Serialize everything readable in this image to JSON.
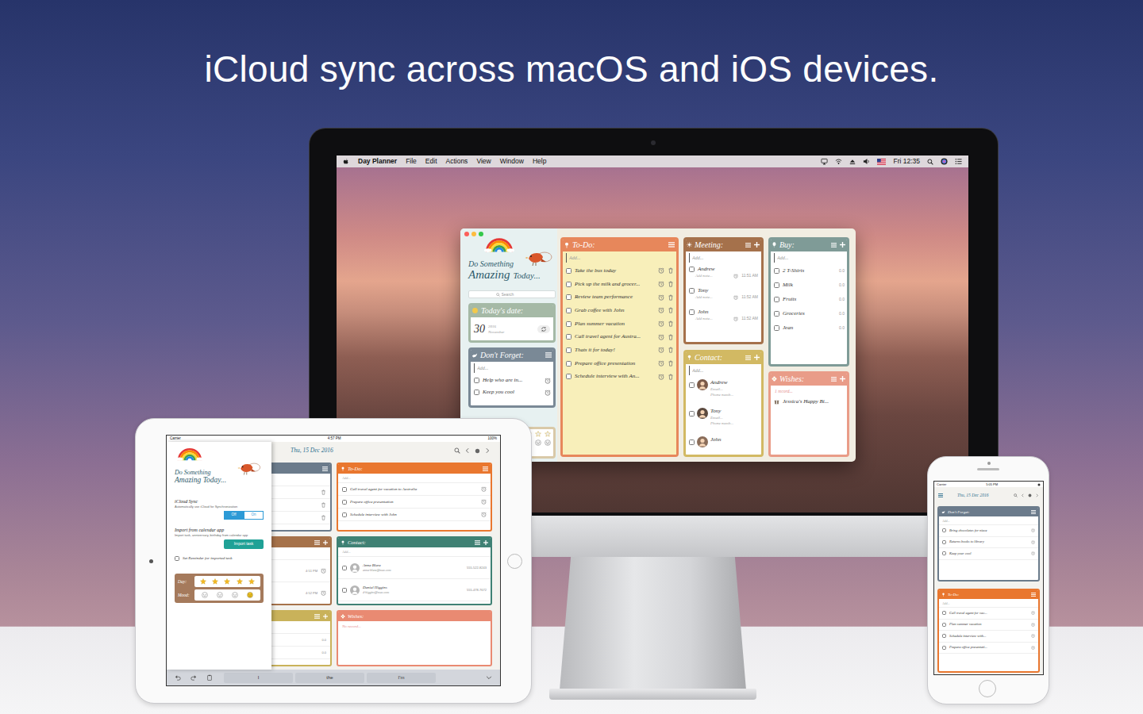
{
  "headline": "iCloud sync across macOS and iOS devices.",
  "mac": {
    "menu_bar": {
      "app": "Day Planner",
      "menus": [
        "File",
        "Edit",
        "Actions",
        "View",
        "Window",
        "Help"
      ],
      "clock": "Fri 12:35"
    },
    "logo": [
      "Do Something",
      "Amazing",
      "Today..."
    ],
    "search": {
      "placeholder": "Search"
    },
    "today": {
      "title": "Today's date:",
      "day": "30",
      "year": "2016",
      "month": "November"
    },
    "dont_forget": {
      "title": "Don't Forget:",
      "placeholder": "Add...",
      "items": [
        {
          "text": "Help who are in...",
          "checked": false
        },
        {
          "text": "Keep you cool",
          "checked": false
        }
      ]
    },
    "rating": {
      "stars": 0
    },
    "todo": {
      "title": "To-Do:",
      "placeholder": "Add...",
      "items": [
        {
          "text": "Take the bus today",
          "checked": false
        },
        {
          "text": "Pick up the milk and grocer...",
          "checked": false
        },
        {
          "text": "Review team performance",
          "checked": false
        },
        {
          "text": "Grab coffee with John",
          "checked": false
        },
        {
          "text": "Plan summer vacation",
          "checked": false
        },
        {
          "text": "Call travel agent for Austra...",
          "checked": false
        },
        {
          "text": "Thats it for today!",
          "checked": false
        },
        {
          "text": "Prepare office presentation",
          "checked": false
        },
        {
          "text": "Schedule interview with An...",
          "checked": false
        }
      ]
    },
    "meeting": {
      "title": "Meeting:",
      "placeholder": "Add...",
      "items": [
        {
          "name": "Andrew",
          "note": "Add note...",
          "time": "11:51 AM",
          "checked": false
        },
        {
          "name": "Tony",
          "note": "Add note...",
          "time": "11:52 AM",
          "checked": false
        },
        {
          "name": "John",
          "note": "Add note...",
          "time": "11:52 AM",
          "checked": false
        }
      ]
    },
    "buy": {
      "title": "Buy:",
      "placeholder": "Add...",
      "items": [
        {
          "name": "2 T-Shirts",
          "price": "0.0",
          "checked": false
        },
        {
          "name": "Milk",
          "price": "0.0",
          "checked": false
        },
        {
          "name": "Fruits",
          "price": "0.0",
          "checked": false
        },
        {
          "name": "Groceries",
          "price": "0.0",
          "checked": false
        },
        {
          "name": "Jean",
          "price": "0.0",
          "checked": false
        }
      ]
    },
    "contact": {
      "title": "Contact:",
      "placeholder": "Add...",
      "items": [
        {
          "name": "Andrew",
          "email": "Email...",
          "phone": "Phone numb...",
          "checked": false
        },
        {
          "name": "Tony",
          "email": "Email...",
          "phone": "Phone numb...",
          "checked": false
        },
        {
          "name": "John",
          "checked": false
        }
      ]
    },
    "wishes": {
      "title": "Wishes:",
      "count": "1 record...",
      "items": [
        "Jessica's Happy Bi..."
      ]
    }
  },
  "ipad": {
    "status": {
      "carrier": "Carrier",
      "time": "4:57 PM",
      "battery": "100%"
    },
    "date": "Thu, 15 Dec 2016",
    "sidebar": {
      "logo": [
        "Do Something",
        "Amazing Today..."
      ],
      "icloud": {
        "title": "iCloud Sync",
        "subtitle": "Automatically use iCloud for Synchronization",
        "options": [
          {
            "label": "Off",
            "selected": true
          },
          {
            "label": "On",
            "selected": false
          }
        ]
      },
      "import": {
        "title": "Import from calendar app",
        "subtitle": "Import task, anniversary, birthday from calendar app",
        "button": "Import task"
      },
      "reminder": {
        "label": "Set Reminder for imported task",
        "checked": false
      },
      "day": {
        "label": "Day:",
        "stars": 5
      },
      "mood": {
        "label": "Mood:",
        "options": [
          {
            "selected": false
          },
          {
            "selected": false
          },
          {
            "selected": false
          },
          {
            "selected": true
          }
        ]
      }
    },
    "left_cards": [
      {
        "color": "#6b7b8b",
        "can_add": false,
        "rows": [
          {
            "kind": "trash"
          },
          {
            "kind": "trash"
          },
          {
            "kind": "trash"
          }
        ]
      },
      {
        "color": "#a6724a",
        "can_add": true,
        "rows": [
          {
            "kind": "time",
            "reading": "4:51 PM"
          },
          {
            "kind": "time",
            "reading": "4:52 PM"
          }
        ]
      },
      {
        "color": "#c9b25a",
        "can_add": true,
        "rows": [
          {
            "kind": "price",
            "reading": "0.0"
          },
          {
            "kind": "price",
            "reading": "0.0"
          }
        ]
      }
    ],
    "todo": {
      "title": "To-Do:",
      "placeholder": "Add...",
      "items": [
        {
          "text": "Call travel agent for vacation to Australia",
          "checked": false
        },
        {
          "text": "Prepare office presentation",
          "checked": false
        },
        {
          "text": "Schedule interview with John",
          "checked": false
        }
      ]
    },
    "contact": {
      "title": "Contact:",
      "placeholder": "Add...",
      "items": [
        {
          "name": "Anna Blare",
          "email": "anna-blare@mac.com",
          "phone": "555-522-8243",
          "checked": false
        },
        {
          "name": "Daniel Higgins",
          "email": "d-higgins@mac.com",
          "phone": "555-478-7672",
          "checked": false
        }
      ]
    },
    "wishes": {
      "title": "Wishes:",
      "empty": "No record..."
    },
    "keyboard": [
      "I",
      "the",
      "I'm"
    ]
  },
  "iphone": {
    "status": {
      "carrier": "Carrier",
      "time": "5:05 PM"
    },
    "date": "Thu, 15 Dec 2016",
    "dont_forget": {
      "title": "Don't Forget:",
      "placeholder": "Add...",
      "items": [
        {
          "text": "Bring chocolates for niece",
          "checked": false
        },
        {
          "text": "Returns books to library",
          "checked": false
        },
        {
          "text": "Keep your cool",
          "checked": false
        }
      ]
    },
    "todo": {
      "title": "To-Do:",
      "placeholder": "Add...",
      "items": [
        {
          "text": "Call travel agent for vac...",
          "checked": false
        },
        {
          "text": "Plan summer vacation",
          "checked": false
        },
        {
          "text": "Schedule interview with...",
          "checked": false
        },
        {
          "text": "Prepare office presentati...",
          "checked": false
        }
      ]
    }
  }
}
